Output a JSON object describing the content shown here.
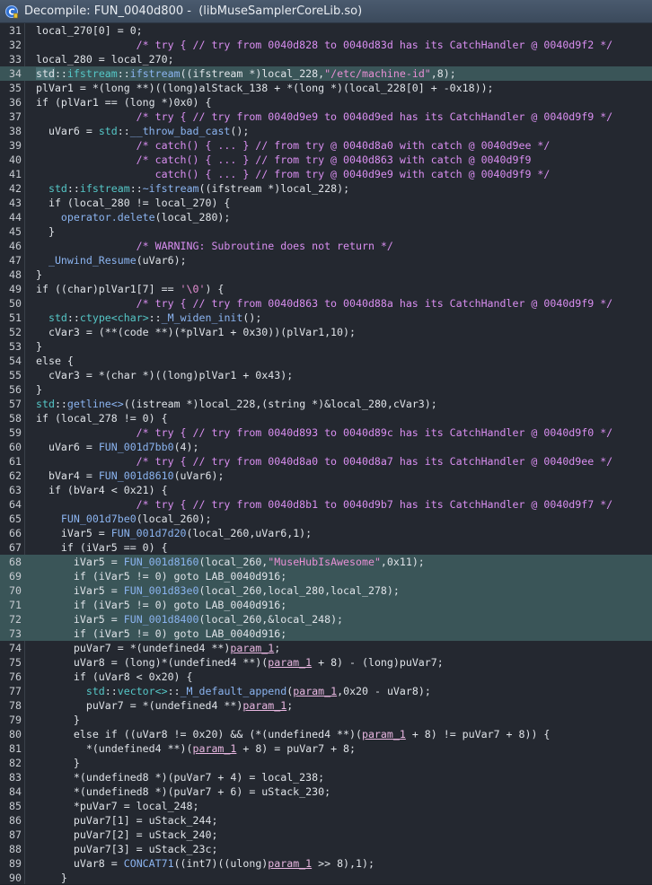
{
  "window": {
    "title": "Decompile: FUN_0040d800 -  (libMuseSamplerCoreLib.so)"
  },
  "code": {
    "lines": [
      {
        "n": "31",
        "hl": false,
        "seg": [
          {
            "t": "local_270[0] = 0;",
            "c": "def"
          }
        ]
      },
      {
        "n": "32",
        "hl": false,
        "seg": [
          {
            "t": "                /* try { // try from 0040d828 to 0040d83d has its CatchHandler @ 0040d9f2 */",
            "c": "com"
          }
        ]
      },
      {
        "n": "33",
        "hl": false,
        "seg": [
          {
            "t": "local_280 = local_270;",
            "c": "def"
          }
        ]
      },
      {
        "n": "34",
        "hl": true,
        "seg": [
          {
            "t": "std",
            "c": "sel"
          },
          {
            "t": "::",
            "c": "def"
          },
          {
            "t": "ifstream",
            "c": "ns"
          },
          {
            "t": "::",
            "c": "def"
          },
          {
            "t": "ifstream",
            "c": "fn"
          },
          {
            "t": "((ifstream *)local_228,",
            "c": "def"
          },
          {
            "t": "\"/etc/machine-id\"",
            "c": "str"
          },
          {
            "t": ",8);",
            "c": "def"
          }
        ]
      },
      {
        "n": "35",
        "hl": false,
        "seg": [
          {
            "t": "plVar1 = *(long **)((long)alStack_138 + *(long *)(local_228[0] + -0x18));",
            "c": "def"
          }
        ]
      },
      {
        "n": "36",
        "hl": false,
        "seg": [
          {
            "t": "if (plVar1 == (long *)0x0) {",
            "c": "def"
          }
        ]
      },
      {
        "n": "37",
        "hl": false,
        "seg": [
          {
            "t": "                /* try { // try from 0040d9e9 to 0040d9ed has its CatchHandler @ 0040d9f9 */",
            "c": "com"
          }
        ]
      },
      {
        "n": "38",
        "hl": false,
        "seg": [
          {
            "t": "  uVar6 = ",
            "c": "def"
          },
          {
            "t": "std",
            "c": "ns"
          },
          {
            "t": "::",
            "c": "def"
          },
          {
            "t": "__throw_bad_cast",
            "c": "fn"
          },
          {
            "t": "();",
            "c": "def"
          }
        ]
      },
      {
        "n": "39",
        "hl": false,
        "seg": [
          {
            "t": "                /* catch() { ... } // from try @ 0040d8a0 with catch @ 0040d9ee */",
            "c": "com"
          }
        ]
      },
      {
        "n": "40",
        "hl": false,
        "seg": [
          {
            "t": "                /* catch() { ... } // from try @ 0040d863 with catch @ 0040d9f9",
            "c": "com"
          }
        ]
      },
      {
        "n": "41",
        "hl": false,
        "seg": [
          {
            "t": "                   catch() { ... } // from try @ 0040d9e9 with catch @ 0040d9f9 */",
            "c": "com"
          }
        ]
      },
      {
        "n": "42",
        "hl": false,
        "seg": [
          {
            "t": "  ",
            "c": "def"
          },
          {
            "t": "std",
            "c": "ns"
          },
          {
            "t": "::",
            "c": "def"
          },
          {
            "t": "ifstream",
            "c": "ns"
          },
          {
            "t": "::",
            "c": "def"
          },
          {
            "t": "~ifstream",
            "c": "fn"
          },
          {
            "t": "((ifstream *)local_228);",
            "c": "def"
          }
        ]
      },
      {
        "n": "43",
        "hl": false,
        "seg": [
          {
            "t": "  if (local_280 != local_270) {",
            "c": "def"
          }
        ]
      },
      {
        "n": "44",
        "hl": false,
        "seg": [
          {
            "t": "    ",
            "c": "def"
          },
          {
            "t": "operator.delete",
            "c": "fn"
          },
          {
            "t": "(local_280);",
            "c": "def"
          }
        ]
      },
      {
        "n": "45",
        "hl": false,
        "seg": [
          {
            "t": "  }",
            "c": "def"
          }
        ]
      },
      {
        "n": "46",
        "hl": false,
        "seg": [
          {
            "t": "                /* WARNING: Subroutine does not return */",
            "c": "com"
          }
        ]
      },
      {
        "n": "47",
        "hl": false,
        "seg": [
          {
            "t": "  ",
            "c": "def"
          },
          {
            "t": "_Unwind_Resume",
            "c": "fn"
          },
          {
            "t": "(uVar6);",
            "c": "def"
          }
        ]
      },
      {
        "n": "48",
        "hl": false,
        "seg": [
          {
            "t": "}",
            "c": "def"
          }
        ]
      },
      {
        "n": "49",
        "hl": false,
        "seg": [
          {
            "t": "if ((char)plVar1[7] == ",
            "c": "def"
          },
          {
            "t": "'\\0'",
            "c": "str"
          },
          {
            "t": ") {",
            "c": "def"
          }
        ]
      },
      {
        "n": "50",
        "hl": false,
        "seg": [
          {
            "t": "                /* try { // try from 0040d863 to 0040d88a has its CatchHandler @ 0040d9f9 */",
            "c": "com"
          }
        ]
      },
      {
        "n": "51",
        "hl": false,
        "seg": [
          {
            "t": "  ",
            "c": "def"
          },
          {
            "t": "std",
            "c": "ns"
          },
          {
            "t": "::",
            "c": "def"
          },
          {
            "t": "ctype<char>",
            "c": "ns"
          },
          {
            "t": "::",
            "c": "def"
          },
          {
            "t": "_M_widen_init",
            "c": "fn"
          },
          {
            "t": "();",
            "c": "def"
          }
        ]
      },
      {
        "n": "52",
        "hl": false,
        "seg": [
          {
            "t": "  cVar3 = (**(code **)(*plVar1 + 0x30))(plVar1,10);",
            "c": "def"
          }
        ]
      },
      {
        "n": "53",
        "hl": false,
        "seg": [
          {
            "t": "}",
            "c": "def"
          }
        ]
      },
      {
        "n": "54",
        "hl": false,
        "seg": [
          {
            "t": "else {",
            "c": "def"
          }
        ]
      },
      {
        "n": "55",
        "hl": false,
        "seg": [
          {
            "t": "  cVar3 = *(char *)((long)plVar1 + 0x43);",
            "c": "def"
          }
        ]
      },
      {
        "n": "56",
        "hl": false,
        "seg": [
          {
            "t": "}",
            "c": "def"
          }
        ]
      },
      {
        "n": "57",
        "hl": false,
        "seg": [
          {
            "t": "std",
            "c": "ns"
          },
          {
            "t": "::",
            "c": "def"
          },
          {
            "t": "getline<>",
            "c": "fn"
          },
          {
            "t": "((istream *)local_228,(string *)&local_280,cVar3);",
            "c": "def"
          }
        ]
      },
      {
        "n": "58",
        "hl": false,
        "seg": [
          {
            "t": "if (local_278 != 0) {",
            "c": "def"
          }
        ]
      },
      {
        "n": "59",
        "hl": false,
        "seg": [
          {
            "t": "                /* try { // try from 0040d893 to 0040d89c has its CatchHandler @ 0040d9f0 */",
            "c": "com"
          }
        ]
      },
      {
        "n": "60",
        "hl": false,
        "seg": [
          {
            "t": "  uVar6 = ",
            "c": "def"
          },
          {
            "t": "FUN_001d7bb0",
            "c": "fn"
          },
          {
            "t": "(4);",
            "c": "def"
          }
        ]
      },
      {
        "n": "61",
        "hl": false,
        "seg": [
          {
            "t": "                /* try { // try from 0040d8a0 to 0040d8a7 has its CatchHandler @ 0040d9ee */",
            "c": "com"
          }
        ]
      },
      {
        "n": "62",
        "hl": false,
        "seg": [
          {
            "t": "  bVar4 = ",
            "c": "def"
          },
          {
            "t": "FUN_001d8610",
            "c": "fn"
          },
          {
            "t": "(uVar6);",
            "c": "def"
          }
        ]
      },
      {
        "n": "63",
        "hl": false,
        "seg": [
          {
            "t": "  if (bVar4 < 0x21) {",
            "c": "def"
          }
        ]
      },
      {
        "n": "64",
        "hl": false,
        "seg": [
          {
            "t": "                /* try { // try from 0040d8b1 to 0040d9b7 has its CatchHandler @ 0040d9f7 */",
            "c": "com"
          }
        ]
      },
      {
        "n": "65",
        "hl": false,
        "seg": [
          {
            "t": "    ",
            "c": "def"
          },
          {
            "t": "FUN_001d7be0",
            "c": "fn"
          },
          {
            "t": "(local_260);",
            "c": "def"
          }
        ]
      },
      {
        "n": "66",
        "hl": false,
        "seg": [
          {
            "t": "    iVar5 = ",
            "c": "def"
          },
          {
            "t": "FUN_001d7d20",
            "c": "fn"
          },
          {
            "t": "(local_260,uVar6,1);",
            "c": "def"
          }
        ]
      },
      {
        "n": "67",
        "hl": false,
        "seg": [
          {
            "t": "    if (iVar5 == 0) {",
            "c": "def"
          }
        ]
      },
      {
        "n": "68",
        "hl": true,
        "seg": [
          {
            "t": "      iVar5 = ",
            "c": "def"
          },
          {
            "t": "FUN_001d8160",
            "c": "fn"
          },
          {
            "t": "(local_260,",
            "c": "def"
          },
          {
            "t": "\"MuseHubIsAwesome\"",
            "c": "str"
          },
          {
            "t": ",0x11);",
            "c": "def"
          }
        ]
      },
      {
        "n": "69",
        "hl": true,
        "seg": [
          {
            "t": "      if (iVar5 != 0) goto LAB_0040d916;",
            "c": "def"
          }
        ]
      },
      {
        "n": "70",
        "hl": true,
        "seg": [
          {
            "t": "      iVar5 = ",
            "c": "def"
          },
          {
            "t": "FUN_001d83e0",
            "c": "fn"
          },
          {
            "t": "(local_260,local_280,local_278);",
            "c": "def"
          }
        ]
      },
      {
        "n": "71",
        "hl": true,
        "seg": [
          {
            "t": "      if (iVar5 != 0) goto LAB_0040d916;",
            "c": "def"
          }
        ]
      },
      {
        "n": "72",
        "hl": true,
        "seg": [
          {
            "t": "      iVar5 = ",
            "c": "def"
          },
          {
            "t": "FUN_001d8400",
            "c": "fn"
          },
          {
            "t": "(local_260,&local_248);",
            "c": "def"
          }
        ]
      },
      {
        "n": "73",
        "hl": true,
        "seg": [
          {
            "t": "      if (iVar5 != 0) goto LAB_0040d916;",
            "c": "def"
          }
        ]
      },
      {
        "n": "74",
        "hl": false,
        "seg": [
          {
            "t": "      puVar7 = *(undefined4 **)",
            "c": "def"
          },
          {
            "t": "param_1",
            "c": "param"
          },
          {
            "t": ";",
            "c": "def"
          }
        ]
      },
      {
        "n": "75",
        "hl": false,
        "seg": [
          {
            "t": "      uVar8 = (long)*(undefined4 **)(",
            "c": "def"
          },
          {
            "t": "param_1",
            "c": "param"
          },
          {
            "t": " + 8) - (long)puVar7;",
            "c": "def"
          }
        ]
      },
      {
        "n": "76",
        "hl": false,
        "seg": [
          {
            "t": "      if (uVar8 < 0x20) {",
            "c": "def"
          }
        ]
      },
      {
        "n": "77",
        "hl": false,
        "seg": [
          {
            "t": "        ",
            "c": "def"
          },
          {
            "t": "std",
            "c": "ns"
          },
          {
            "t": "::",
            "c": "def"
          },
          {
            "t": "vector<>",
            "c": "ns"
          },
          {
            "t": "::",
            "c": "def"
          },
          {
            "t": "_M_default_append",
            "c": "fn"
          },
          {
            "t": "(",
            "c": "def"
          },
          {
            "t": "param_1",
            "c": "param"
          },
          {
            "t": ",0x20 - uVar8);",
            "c": "def"
          }
        ]
      },
      {
        "n": "78",
        "hl": false,
        "seg": [
          {
            "t": "        puVar7 = *(undefined4 **)",
            "c": "def"
          },
          {
            "t": "param_1",
            "c": "param"
          },
          {
            "t": ";",
            "c": "def"
          }
        ]
      },
      {
        "n": "79",
        "hl": false,
        "seg": [
          {
            "t": "      }",
            "c": "def"
          }
        ]
      },
      {
        "n": "80",
        "hl": false,
        "seg": [
          {
            "t": "      else if ((uVar8 != 0x20) && (*(undefined4 **)(",
            "c": "def"
          },
          {
            "t": "param_1",
            "c": "param"
          },
          {
            "t": " + 8) != puVar7 + 8)) {",
            "c": "def"
          }
        ]
      },
      {
        "n": "81",
        "hl": false,
        "seg": [
          {
            "t": "        *(undefined4 **)(",
            "c": "def"
          },
          {
            "t": "param_1",
            "c": "param"
          },
          {
            "t": " + 8) = puVar7 + 8;",
            "c": "def"
          }
        ]
      },
      {
        "n": "82",
        "hl": false,
        "seg": [
          {
            "t": "      }",
            "c": "def"
          }
        ]
      },
      {
        "n": "83",
        "hl": false,
        "seg": [
          {
            "t": "      *(undefined8 *)(puVar7 + 4) = local_238;",
            "c": "def"
          }
        ]
      },
      {
        "n": "84",
        "hl": false,
        "seg": [
          {
            "t": "      *(undefined8 *)(puVar7 + 6) = uStack_230;",
            "c": "def"
          }
        ]
      },
      {
        "n": "85",
        "hl": false,
        "seg": [
          {
            "t": "      *puVar7 = local_248;",
            "c": "def"
          }
        ]
      },
      {
        "n": "86",
        "hl": false,
        "seg": [
          {
            "t": "      puVar7[1] = uStack_244;",
            "c": "def"
          }
        ]
      },
      {
        "n": "87",
        "hl": false,
        "seg": [
          {
            "t": "      puVar7[2] = uStack_240;",
            "c": "def"
          }
        ]
      },
      {
        "n": "88",
        "hl": false,
        "seg": [
          {
            "t": "      puVar7[3] = uStack_23c;",
            "c": "def"
          }
        ]
      },
      {
        "n": "89",
        "hl": false,
        "seg": [
          {
            "t": "      uVar8 = ",
            "c": "def"
          },
          {
            "t": "CONCAT71",
            "c": "fn"
          },
          {
            "t": "((int7)((ulong)",
            "c": "def"
          },
          {
            "t": "param_1",
            "c": "param"
          },
          {
            "t": " >> 8),1);",
            "c": "def"
          }
        ]
      },
      {
        "n": "90",
        "hl": false,
        "seg": [
          {
            "t": "    }",
            "c": "def"
          }
        ]
      }
    ]
  },
  "colors": {
    "background": "#242830",
    "highlight": "#3a5558",
    "comment": "#d98ef0",
    "function": "#8bb4f0",
    "string": "#e78fd4",
    "namespace": "#55c7c7"
  },
  "icons": {
    "title": "decompile-icon"
  }
}
